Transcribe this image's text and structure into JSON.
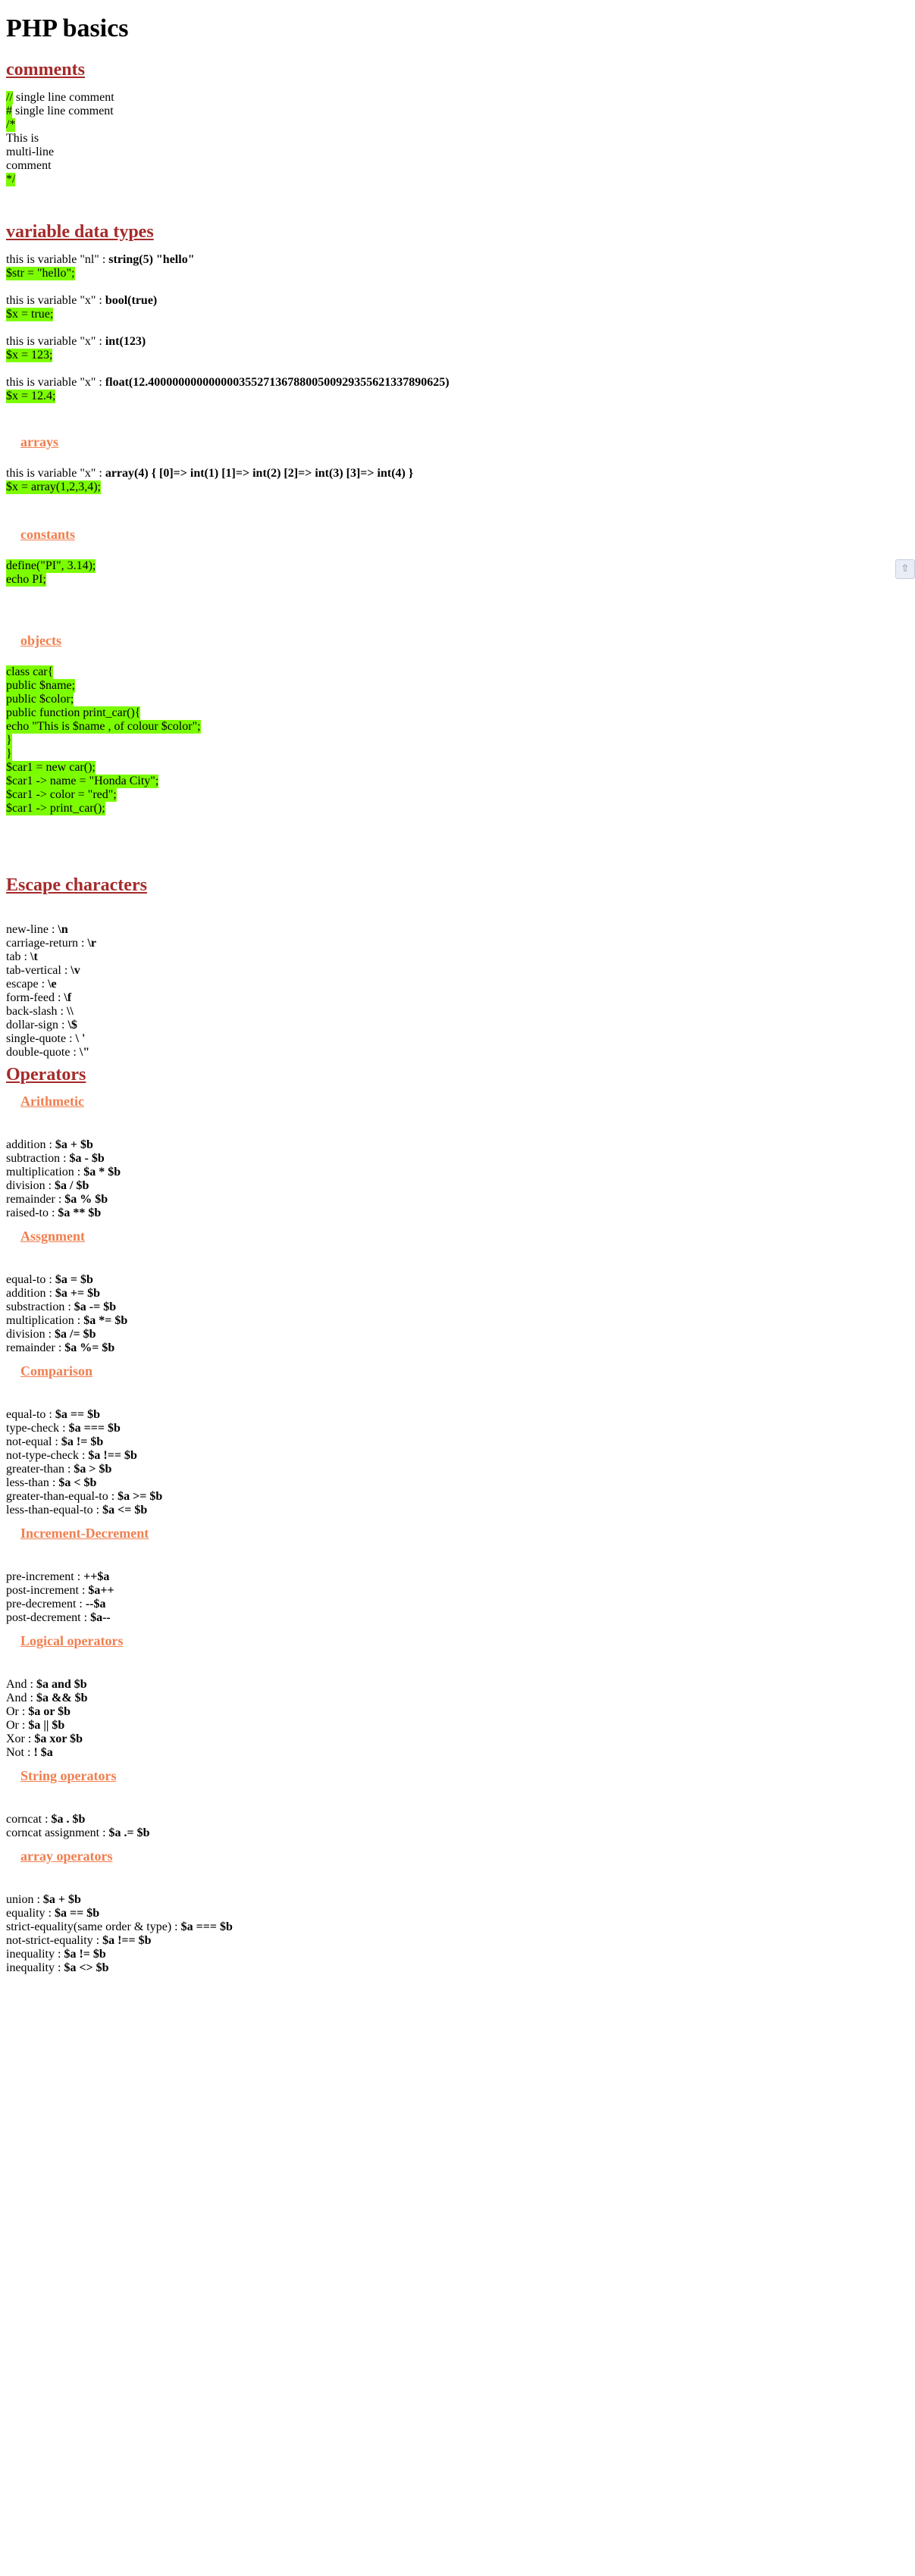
{
  "title": "PHP basics",
  "comments": {
    "heading": "comments",
    "lines": [
      {
        "marker": "//",
        "text": " single line comment"
      },
      {
        "marker": "#",
        "text": " single line comment"
      },
      {
        "marker": "/*",
        "text": ""
      },
      {
        "marker": "",
        "text": "This is"
      },
      {
        "marker": "",
        "text": "multi-line"
      },
      {
        "marker": "",
        "text": "comment"
      },
      {
        "marker": "*/",
        "text": ""
      }
    ]
  },
  "variables": {
    "heading": "variable data types",
    "items": [
      {
        "desc": "this is variable \"nl\" : ",
        "type": "string(5) \"hello\"",
        "code": "$str = \"hello\";"
      },
      {
        "desc": "this is variable \"x\" : ",
        "type": "bool(true)",
        "code": "$x = true;"
      },
      {
        "desc": "this is variable \"x\" : ",
        "type": "int(123)",
        "code": "$x = 123;"
      },
      {
        "desc": "this is variable \"x\" : ",
        "type": "float(12.4000000000000003552713678800500929355621337890625)",
        "code": "$x = 12.4;"
      }
    ],
    "arrays": {
      "heading": "arrays",
      "desc": "this is variable \"x\" : ",
      "type": "array(4) { [0]=> int(1) [1]=> int(2) [2]=> int(3) [3]=> int(4) }",
      "code": "$x = array(1,2,3,4);"
    },
    "constants": {
      "heading": "constants",
      "code": [
        "define(\"PI\", 3.14);",
        "echo PI;"
      ]
    },
    "objects": {
      "heading": "objects",
      "code": [
        "class car{",
        "public $name;",
        "public $color;",
        "public function print_car(){",
        "echo \"This is $name , of colour $color\";",
        "}",
        "}",
        "$car1 = new car();",
        "$car1 -> name = \"Honda City\";",
        "$car1 -> color = \"red\";",
        "$car1 -> print_car();"
      ]
    }
  },
  "escape": {
    "heading": "Escape characters",
    "items": [
      {
        "label": "new-line : ",
        "value": "\\n"
      },
      {
        "label": "carriage-return : ",
        "value": "\\r"
      },
      {
        "label": "tab : ",
        "value": "\\t"
      },
      {
        "label": "tab-vertical : ",
        "value": "\\v"
      },
      {
        "label": "escape : ",
        "value": "\\e"
      },
      {
        "label": "form-feed : ",
        "value": "\\f"
      },
      {
        "label": "back-slash : ",
        "value": "\\\\"
      },
      {
        "label": "dollar-sign : ",
        "value": "\\$"
      },
      {
        "label": "single-quote : ",
        "value": "\\ '"
      },
      {
        "label": "double-quote : ",
        "value": "\\\""
      }
    ]
  },
  "operators": {
    "heading": "Operators",
    "groups": [
      {
        "heading": "Arithmetic",
        "items": [
          {
            "label": "addition : ",
            "value": "$a + $b"
          },
          {
            "label": "subtraction : ",
            "value": "$a - $b"
          },
          {
            "label": "multiplication : ",
            "value": "$a * $b"
          },
          {
            "label": "division : ",
            "value": "$a / $b"
          },
          {
            "label": "remainder : ",
            "value": "$a % $b"
          },
          {
            "label": "raised-to : ",
            "value": "$a ** $b"
          }
        ]
      },
      {
        "heading": "Assgnment",
        "items": [
          {
            "label": "equal-to : ",
            "value": "$a = $b"
          },
          {
            "label": "addition : ",
            "value": "$a += $b"
          },
          {
            "label": "substraction : ",
            "value": "$a -= $b"
          },
          {
            "label": "multiplication : ",
            "value": "$a *= $b"
          },
          {
            "label": "division : ",
            "value": "$a /= $b"
          },
          {
            "label": "remainder : ",
            "value": "$a %= $b"
          }
        ]
      },
      {
        "heading": "Comparison",
        "items": [
          {
            "label": "equal-to : ",
            "value": "$a == $b"
          },
          {
            "label": "type-check : ",
            "value": "$a === $b"
          },
          {
            "label": "not-equal : ",
            "value": "$a != $b"
          },
          {
            "label": "not-type-check : ",
            "value": "$a !== $b"
          },
          {
            "label": "greater-than : ",
            "value": "$a > $b"
          },
          {
            "label": "less-than : ",
            "value": "$a < $b"
          },
          {
            "label": "greater-than-equal-to : ",
            "value": "$a >= $b"
          },
          {
            "label": "less-than-equal-to : ",
            "value": "$a <= $b"
          }
        ]
      },
      {
        "heading": "Increment-Decrement",
        "items": [
          {
            "label": "pre-increment : ",
            "value": "++$a"
          },
          {
            "label": "post-increment : ",
            "value": "$a++"
          },
          {
            "label": "pre-decrement : ",
            "value": "--$a"
          },
          {
            "label": "post-decrement : ",
            "value": "$a--"
          }
        ]
      },
      {
        "heading": "Logical operators",
        "items": [
          {
            "label": "And : ",
            "value": "$a and $b"
          },
          {
            "label": "And : ",
            "value": "$a && $b"
          },
          {
            "label": "Or : ",
            "value": "$a or $b"
          },
          {
            "label": "Or : ",
            "value": "$a || $b"
          },
          {
            "label": "Xor : ",
            "value": "$a xor $b"
          },
          {
            "label": "Not : ",
            "value": "! $a"
          }
        ]
      },
      {
        "heading": "String operators",
        "items": [
          {
            "label": "corncat : ",
            "value": "$a . $b"
          },
          {
            "label": "corncat assignment : ",
            "value": "$a .= $b"
          }
        ]
      },
      {
        "heading": "array operators",
        "items": [
          {
            "label": "union : ",
            "value": "$a + $b"
          },
          {
            "label": "equality : ",
            "value": "$a == $b"
          },
          {
            "label": "strict-equality(same order & type) : ",
            "value": "$a === $b"
          },
          {
            "label": "not-strict-equality : ",
            "value": "$a !== $b"
          },
          {
            "label": "inequality : ",
            "value": "$a != $b"
          },
          {
            "label": "inequality : ",
            "value": "$a <> $b"
          }
        ]
      }
    ]
  },
  "scroll_icon": "scroll-to-top-icon",
  "colors": {
    "code_highlight": "#7cfc00",
    "section_heading": "#a52a2a",
    "sub_heading": "#f07f4f"
  }
}
